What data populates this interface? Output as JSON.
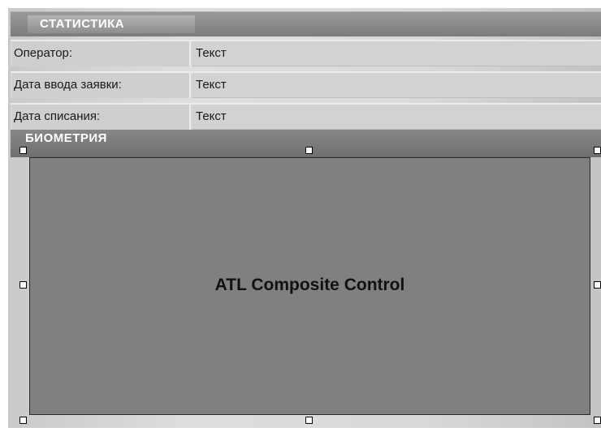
{
  "statistics": {
    "title": "СТАТИСТИКА",
    "rows": [
      {
        "label": "Оператор:",
        "value": "Текст"
      },
      {
        "label": "Дата ввода заявки:",
        "value": "Текст"
      },
      {
        "label": "Дата списания:",
        "value": "Текст"
      }
    ]
  },
  "biometry": {
    "title": "БИОМЕТРИЯ",
    "control_label": "ATL Composite Control"
  }
}
